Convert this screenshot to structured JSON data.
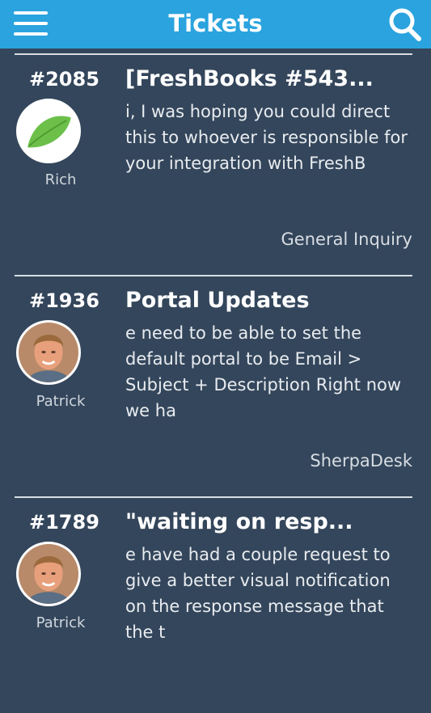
{
  "header": {
    "title": "Tickets",
    "menu_icon": "hamburger-menu-icon",
    "search_icon": "search-icon"
  },
  "tickets": [
    {
      "number": "#2085",
      "subject": "[FreshBooks #543...",
      "body": "i, I was hoping you could direct this to whoever is responsible for your integration with FreshB",
      "author": "Rich",
      "avatar": "leaf-logo",
      "category": "General Inquiry"
    },
    {
      "number": "#1936",
      "subject": "Portal Updates",
      "body": "e need to be able to set the default portal to be Email > Subject + Description Right now we ha",
      "author": "Patrick",
      "avatar": "person-photo",
      "category": "SherpaDesk"
    },
    {
      "number": "#1789",
      "subject": "\"waiting on resp...",
      "body": "e have had a couple request to give a better visual notification on the response message that the t",
      "author": "Patrick",
      "avatar": "person-photo",
      "category": ""
    }
  ],
  "colors": {
    "header": "#2aa3de",
    "background": "#34465b",
    "divider": "#d7dde3"
  }
}
